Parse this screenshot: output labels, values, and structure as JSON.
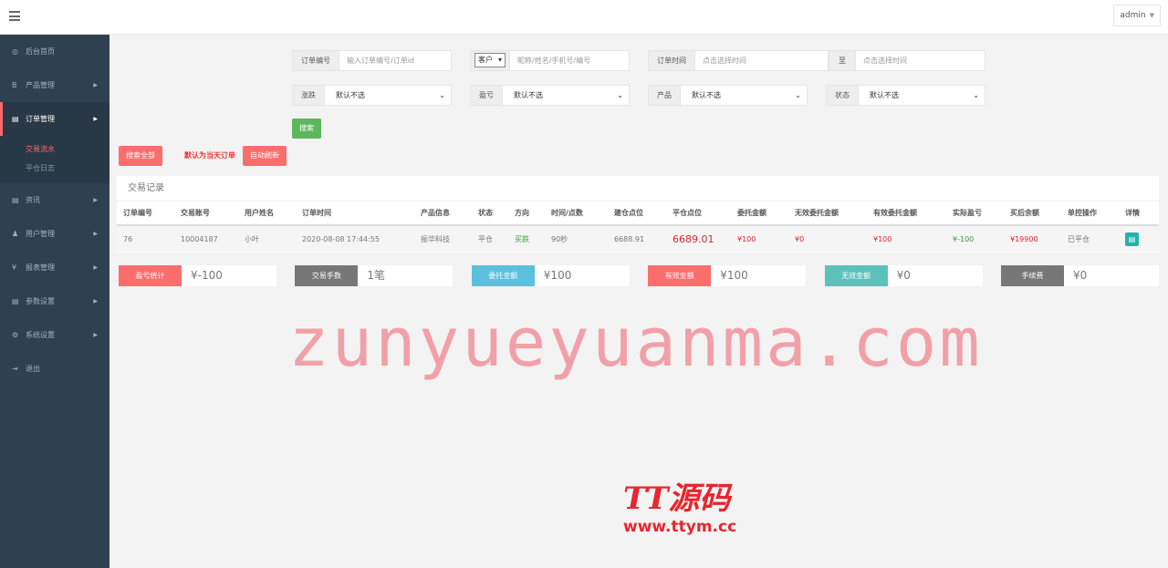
{
  "header": {
    "admin_label": "admin"
  },
  "sidebar": {
    "items": [
      {
        "label": "后台首页",
        "icon": "dashboard-icon",
        "glyph": "◎"
      },
      {
        "label": "产品管理",
        "icon": "bitcoin-icon",
        "glyph": "B"
      },
      {
        "label": "订单管理",
        "icon": "order-icon",
        "glyph": "▤"
      },
      {
        "label": "资讯",
        "icon": "news-icon",
        "glyph": "▤"
      },
      {
        "label": "用户管理",
        "icon": "user-icon",
        "glyph": "♟"
      },
      {
        "label": "报表管理",
        "icon": "yen-icon",
        "glyph": "¥"
      },
      {
        "label": "参数设置",
        "icon": "params-icon",
        "glyph": "▤"
      },
      {
        "label": "系统设置",
        "icon": "gears-icon",
        "glyph": "⚙"
      },
      {
        "label": "退出",
        "icon": "signout-icon",
        "glyph": "⇥"
      }
    ],
    "order_sub": [
      "交易流水",
      "平仓日志"
    ]
  },
  "filters": {
    "order_no_label": "订单编号",
    "order_no_placeholder": "输入订单编号/订单id",
    "customer_type": "客户",
    "customer_placeholder": "昵称/姓名/手机号/编号",
    "order_time_label": "订单时间",
    "order_time_placeholder": "点击选择时间",
    "to_label": "至",
    "to_placeholder": "点击选择时间",
    "rise_fall_label": "涨跌",
    "profit_label": "盈亏",
    "product_label": "产品",
    "status_label": "状态",
    "default_option": "默认不选",
    "search_button": "搜索"
  },
  "actions": {
    "search_all": "搜索全部",
    "default_note": "默认为当天订单",
    "auto_refresh": "自动刷新"
  },
  "table": {
    "title": "交易记录",
    "columns": [
      "订单编号",
      "交易账号",
      "用户姓名",
      "订单时间",
      "产品信息",
      "状态",
      "方向",
      "时间/点数",
      "建仓点位",
      "平仓点位",
      "委托金额",
      "无效委托金额",
      "有效委托金额",
      "实际盈亏",
      "买后余额",
      "单控操作",
      "详情"
    ],
    "rows": [
      [
        "76",
        "10004187",
        "小叶",
        "2020-08-08 17:44:55",
        "振华科技",
        "平仓",
        "买跌",
        "90秒",
        "6688.91",
        "6689.01",
        "¥100",
        "¥0",
        "¥100",
        "¥-100",
        "¥19900",
        "已平仓",
        ""
      ]
    ]
  },
  "stats": [
    {
      "label": "盈亏统计",
      "value": "¥-100",
      "color": "#fc6d6d"
    },
    {
      "label": "交易手数",
      "value": "1笔",
      "color": "#777777"
    },
    {
      "label": "委托金额",
      "value": "¥100",
      "color": "#5bc0de"
    },
    {
      "label": "有效金额",
      "value": "¥100",
      "color": "#fc6d6d"
    },
    {
      "label": "无效金额",
      "value": "¥0",
      "color": "#5cc1bb"
    },
    {
      "label": "手续费",
      "value": "¥0",
      "color": "#777777"
    }
  ],
  "watermark": {
    "text": "zunyueyuanma.com",
    "logo_brand": "TT源码",
    "logo_url": "www.ttym.cc"
  }
}
